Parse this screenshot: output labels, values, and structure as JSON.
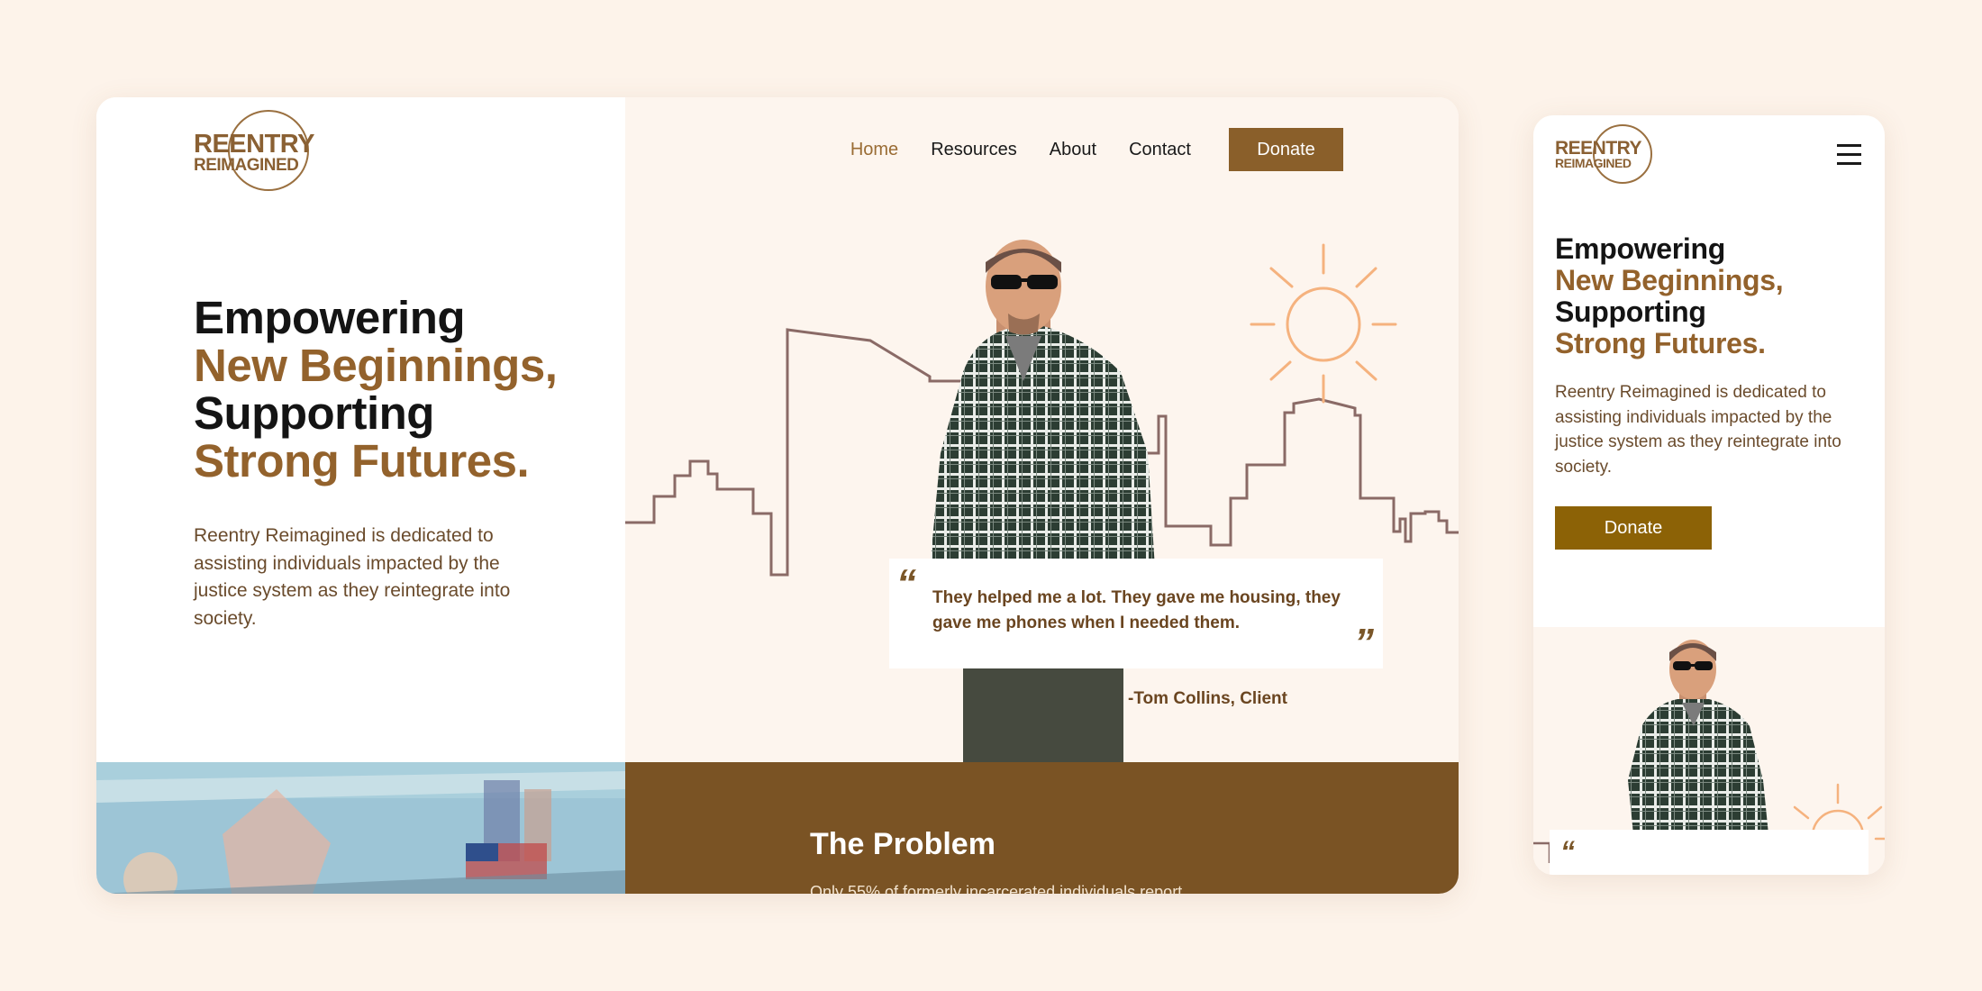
{
  "brand": {
    "logo_line1": "REENTRY",
    "logo_line2": "REIMAGINED",
    "colors": {
      "gold": "#93622c",
      "brown": "#7a5324",
      "cream": "#fdf5ee",
      "background": "#fdf3ea",
      "sun": "#f5b27e",
      "skyline": "#8a6a66",
      "mobile_button": "#8c6206"
    }
  },
  "nav": {
    "items": [
      {
        "label": "Home",
        "active": true
      },
      {
        "label": "Resources",
        "active": false
      },
      {
        "label": "About",
        "active": false
      },
      {
        "label": "Contact",
        "active": false
      }
    ],
    "donate_label": "Donate"
  },
  "hero": {
    "title_line1": "Empowering",
    "title_line2": "New Beginnings,",
    "title_line3": "Supporting",
    "title_line4": "Strong Futures.",
    "description": "Reentry Reimagined is dedicated to assisting individuals impacted by the justice system as they reintegrate into society."
  },
  "testimonial": {
    "quote_open": "“",
    "quote_close": "”",
    "quote": "They helped me a lot. They gave me housing, they gave me phones when I needed them.",
    "attribution": "-Tom Collins, Client"
  },
  "problem": {
    "title": "The Problem",
    "text": "Only 55% of formerly incarcerated individuals report..."
  },
  "mobile": {
    "title_line1": "Empowering",
    "title_line2": "New Beginnings,",
    "title_line3": "Supporting",
    "title_line4": "Strong Futures.",
    "description": "Reentry Reimagined is dedicated to assisting individuals impacted by the justice system as they reintegrate into society.",
    "donate_label": "Donate",
    "menu_icon": "hamburger-icon"
  }
}
